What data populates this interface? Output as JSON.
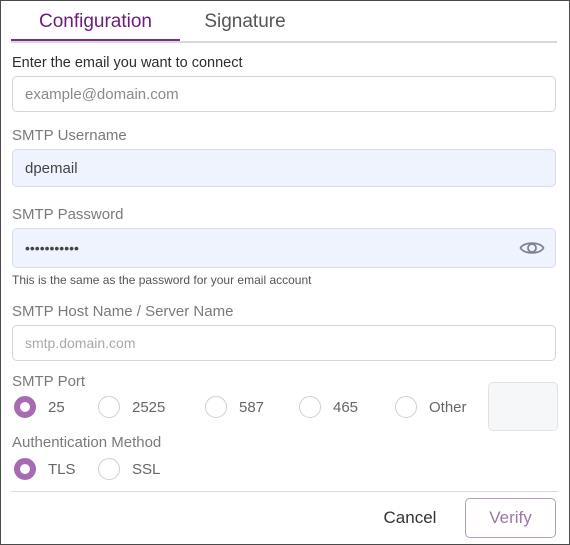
{
  "tabs": [
    {
      "label": "Configuration",
      "active": true
    },
    {
      "label": "Signature",
      "active": false
    }
  ],
  "email": {
    "label": "Enter the email you want to connect",
    "placeholder": "example@domain.com"
  },
  "smtp_username": {
    "label": "SMTP Username",
    "value": "dpemail"
  },
  "smtp_password": {
    "label": "SMTP Password",
    "value": "•••••••••••",
    "help": "This is the same as the password for your email account",
    "icon": "eye-icon"
  },
  "smtp_host": {
    "label": "SMTP Host Name / Server Name",
    "placeholder": "smtp.domain.com"
  },
  "smtp_port": {
    "label": "SMTP Port",
    "options": [
      "25",
      "2525",
      "587",
      "465",
      "Other"
    ],
    "selected": "25"
  },
  "auth_method": {
    "label": "Authentication Method",
    "options": [
      "TLS",
      "SSL"
    ],
    "selected": "TLS"
  },
  "footer": {
    "cancel_label": "Cancel",
    "verify_label": "Verify"
  },
  "colors": {
    "accent": "#7b2b8a",
    "radio_selected": "#a66bb2",
    "filled_input_bg": "#eef3fd"
  }
}
